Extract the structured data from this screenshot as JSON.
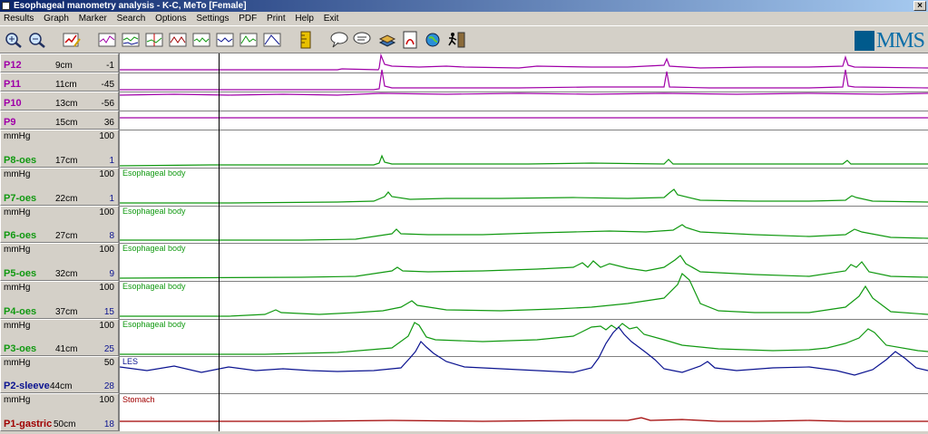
{
  "window": {
    "title": "Esophageal manometry analysis - K-C, MeTo [Female]",
    "close": "×"
  },
  "menu": [
    "Results",
    "Graph",
    "Marker",
    "Search",
    "Options",
    "Settings",
    "PDF",
    "Print",
    "Help",
    "Exit"
  ],
  "toolbar_icons": [
    "zoom-in-icon",
    "zoom-out-icon",
    "edit-chart-icon",
    "chart-view-1-icon",
    "chart-view-2-icon",
    "chart-view-3-icon",
    "chart-view-4-icon",
    "chart-view-5-icon",
    "chart-view-6-icon",
    "chart-view-7-icon",
    "chart-view-8-icon",
    "ruler-icon",
    "comment-bubble-icon",
    "speech-bubble-icon",
    "layers-icon",
    "pdf-document-icon",
    "globe-icon",
    "exit-runner-icon"
  ],
  "logo": "MMS",
  "colors": {
    "magenta": "#a000a8",
    "green": "#119911",
    "blue": "#0b1390",
    "red": "#a00000"
  },
  "channels": [
    {
      "name": "P12",
      "depth": "9cm",
      "value": "-1",
      "unit": "",
      "max": "",
      "color": "#a000a8",
      "label": ""
    },
    {
      "name": "P11",
      "depth": "11cm",
      "value": "-45",
      "unit": "",
      "max": "",
      "color": "#a000a8",
      "label": ""
    },
    {
      "name": "P10",
      "depth": "13cm",
      "value": "-56",
      "unit": "",
      "max": "",
      "color": "#a000a8",
      "label": ""
    },
    {
      "name": "P9",
      "depth": "15cm",
      "value": "36",
      "unit": "",
      "max": "",
      "color": "#a000a8",
      "label": ""
    },
    {
      "name": "P8-oes",
      "depth": "17cm",
      "value": "1",
      "unit": "mmHg",
      "max": "100",
      "color": "#119911",
      "label": ""
    },
    {
      "name": "P7-oes",
      "depth": "22cm",
      "value": "1",
      "unit": "mmHg",
      "max": "100",
      "color": "#119911",
      "label": "Esophageal body"
    },
    {
      "name": "P6-oes",
      "depth": "27cm",
      "value": "8",
      "unit": "mmHg",
      "max": "100",
      "color": "#119911",
      "label": "Esophageal body"
    },
    {
      "name": "P5-oes",
      "depth": "32cm",
      "value": "9",
      "unit": "mmHg",
      "max": "100",
      "color": "#119911",
      "label": "Esophageal body"
    },
    {
      "name": "P4-oes",
      "depth": "37cm",
      "value": "15",
      "unit": "mmHg",
      "max": "100",
      "color": "#119911",
      "label": "Esophageal body"
    },
    {
      "name": "P3-oes",
      "depth": "41cm",
      "value": "25",
      "unit": "mmHg",
      "max": "100",
      "color": "#119911",
      "label": "Esophageal body"
    },
    {
      "name": "P2-sleeve",
      "depth": "44cm",
      "value": "28",
      "unit": "mmHg",
      "max": "50",
      "color": "#0b1390",
      "label": "LES"
    },
    {
      "name": "P1-gastric",
      "depth": "50cm",
      "value": "18",
      "unit": "mmHg",
      "max": "100",
      "color": "#a00000",
      "label": "Stomach"
    }
  ]
}
